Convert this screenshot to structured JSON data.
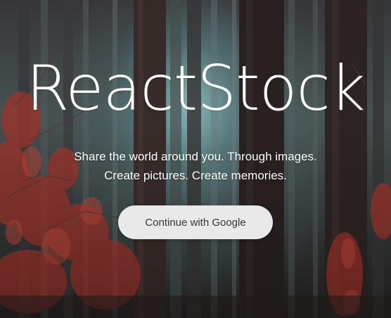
{
  "hero": {
    "title": "ReactStock",
    "tagline_line1": "Share the world around you. Through images.",
    "tagline_line2": "Create pictures. Create memories.",
    "cta_label": "Continue with Google"
  },
  "colors": {
    "title_text": "#ffffff",
    "button_bg": "#e9e9ea",
    "button_text": "#333537",
    "foliage": "#a8352c"
  }
}
